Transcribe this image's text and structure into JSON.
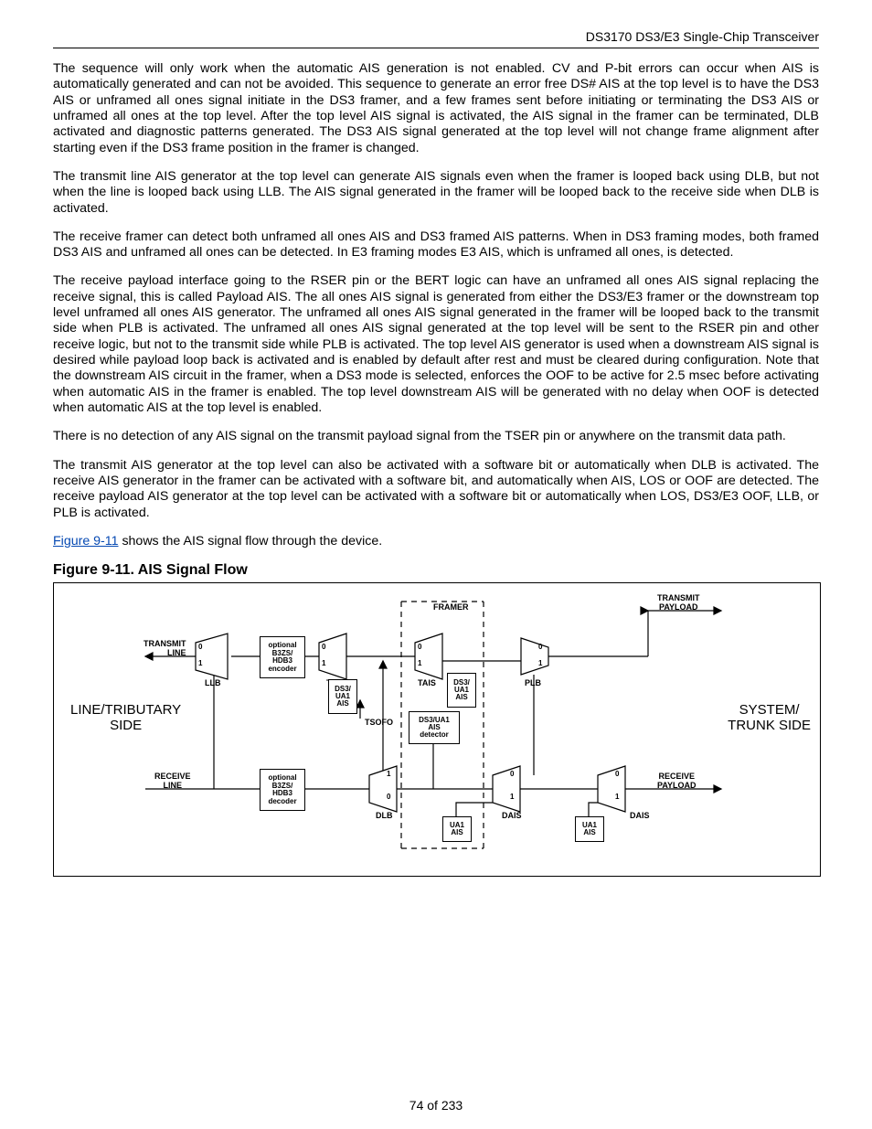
{
  "header": {
    "title": "DS3170 DS3/E3 Single-Chip Transceiver"
  },
  "paragraphs": {
    "p1": "The sequence will only work when the automatic AIS generation is not enabled.  CV and P-bit errors can occur when AIS is automatically generated and can not be avoided.  This sequence to generate an error free DS# AIS at the top level is to have the DS3 AIS or unframed all ones signal initiate in the DS3 framer, and a few frames sent before initiating or terminating the DS3 AIS or unframed all ones at the top level. After the top level AIS signal is activated, the AIS signal in the framer can be terminated, DLB activated and diagnostic patterns generated.  The DS3 AIS signal generated at the top level will not change frame alignment after starting even if the DS3 frame position in the framer is changed.",
    "p2": "The transmit line AIS generator at the top level can generate AIS signals even when the framer is looped back using DLB, but not when the line is looped back using LLB. The AIS signal generated in the framer will be looped back to the receive side when DLB is activated.",
    "p3": "The receive framer can detect both unframed all ones AIS and DS3 framed AIS patterns. When in DS3 framing modes, both framed DS3 AIS and unframed all ones can be detected. In E3 framing modes E3 AIS, which is unframed all ones, is detected.",
    "p4": "The receive payload interface going to the RSER pin or the BERT logic can have an unframed all ones AIS signal replacing the receive signal, this is called Payload AIS.  The all ones AIS signal is generated from either the DS3/E3 framer or the downstream top level unframed all ones AIS generator. The unframed all ones AIS signal generated in the framer will be looped back to the transmit side when PLB is activated. The unframed all ones AIS signal generated at the top level will be sent to the RSER pin and other receive logic, but not to the transmit side while PLB is activated.  The top level AIS generator is used when a downstream AIS signal is desired while payload loop back is activated and is enabled by default after rest and must be cleared during configuration.  Note that the downstream AIS circuit in the framer, when a DS3 mode is selected, enforces the OOF to be active for 2.5 msec before activating when automatic AIS in the framer is enabled.  The top level downstream AIS will be generated with no delay when OOF is detected when automatic AIS at the top level is enabled.",
    "p5": "There is no detection of any AIS signal on the transmit payload signal from the TSER pin or anywhere on the transmit data path.",
    "p6": "The transmit AIS generator at the top level can also be activated with a software bit or automatically when DLB is activated. The receive AIS generator in the framer can be activated with a software bit, and automatically when AIS, LOS or OOF are detected. The receive payload AIS generator at the top level can be activated with a software bit or automatically when LOS, DS3/E3 OOF, LLB, or PLB is activated.",
    "p7_prefix": "",
    "p7_link": "Figure 9-11",
    "p7_suffix": " shows the AIS signal flow through the device."
  },
  "figure": {
    "title": "Figure 9-11. AIS Signal Flow",
    "labels": {
      "line_side": "LINE/TRIBUTARY\nSIDE",
      "system_side": "SYSTEM/\nTRUNK SIDE",
      "transmit_line": "TRANSMIT\nLINE",
      "receive_line": "RECEIVE\nLINE",
      "transmit_payload": "TRANSMIT\nPAYLOAD",
      "receive_payload": "RECEIVE\nPAYLOAD",
      "framer": "FRAMER",
      "encoder": "optional\nB3ZS/\nHDB3\nencoder",
      "decoder": "optional\nB3ZS/\nHDB3\ndecoder",
      "llb": "LLB",
      "tais": "TAIS",
      "tais2": "TAIS",
      "dlb": "DLB",
      "plb": "PLB",
      "dais": "DAIS",
      "dais2": "DAIS",
      "ds3_ua1_ais_t": "DS3/\nUA1\nAIS",
      "ds3_ua1_ais_t2": "DS3/\nUA1\nAIS",
      "ds3_ua1_ais_det": "DS3/UA1\nAIS\ndetector",
      "ua1_ais": "UA1\nAIS",
      "ua1_ais2": "UA1\nAIS",
      "tsofo": "TSOFO",
      "zero": "0",
      "one": "1"
    }
  },
  "footer": {
    "page_info": "74 of 233"
  }
}
